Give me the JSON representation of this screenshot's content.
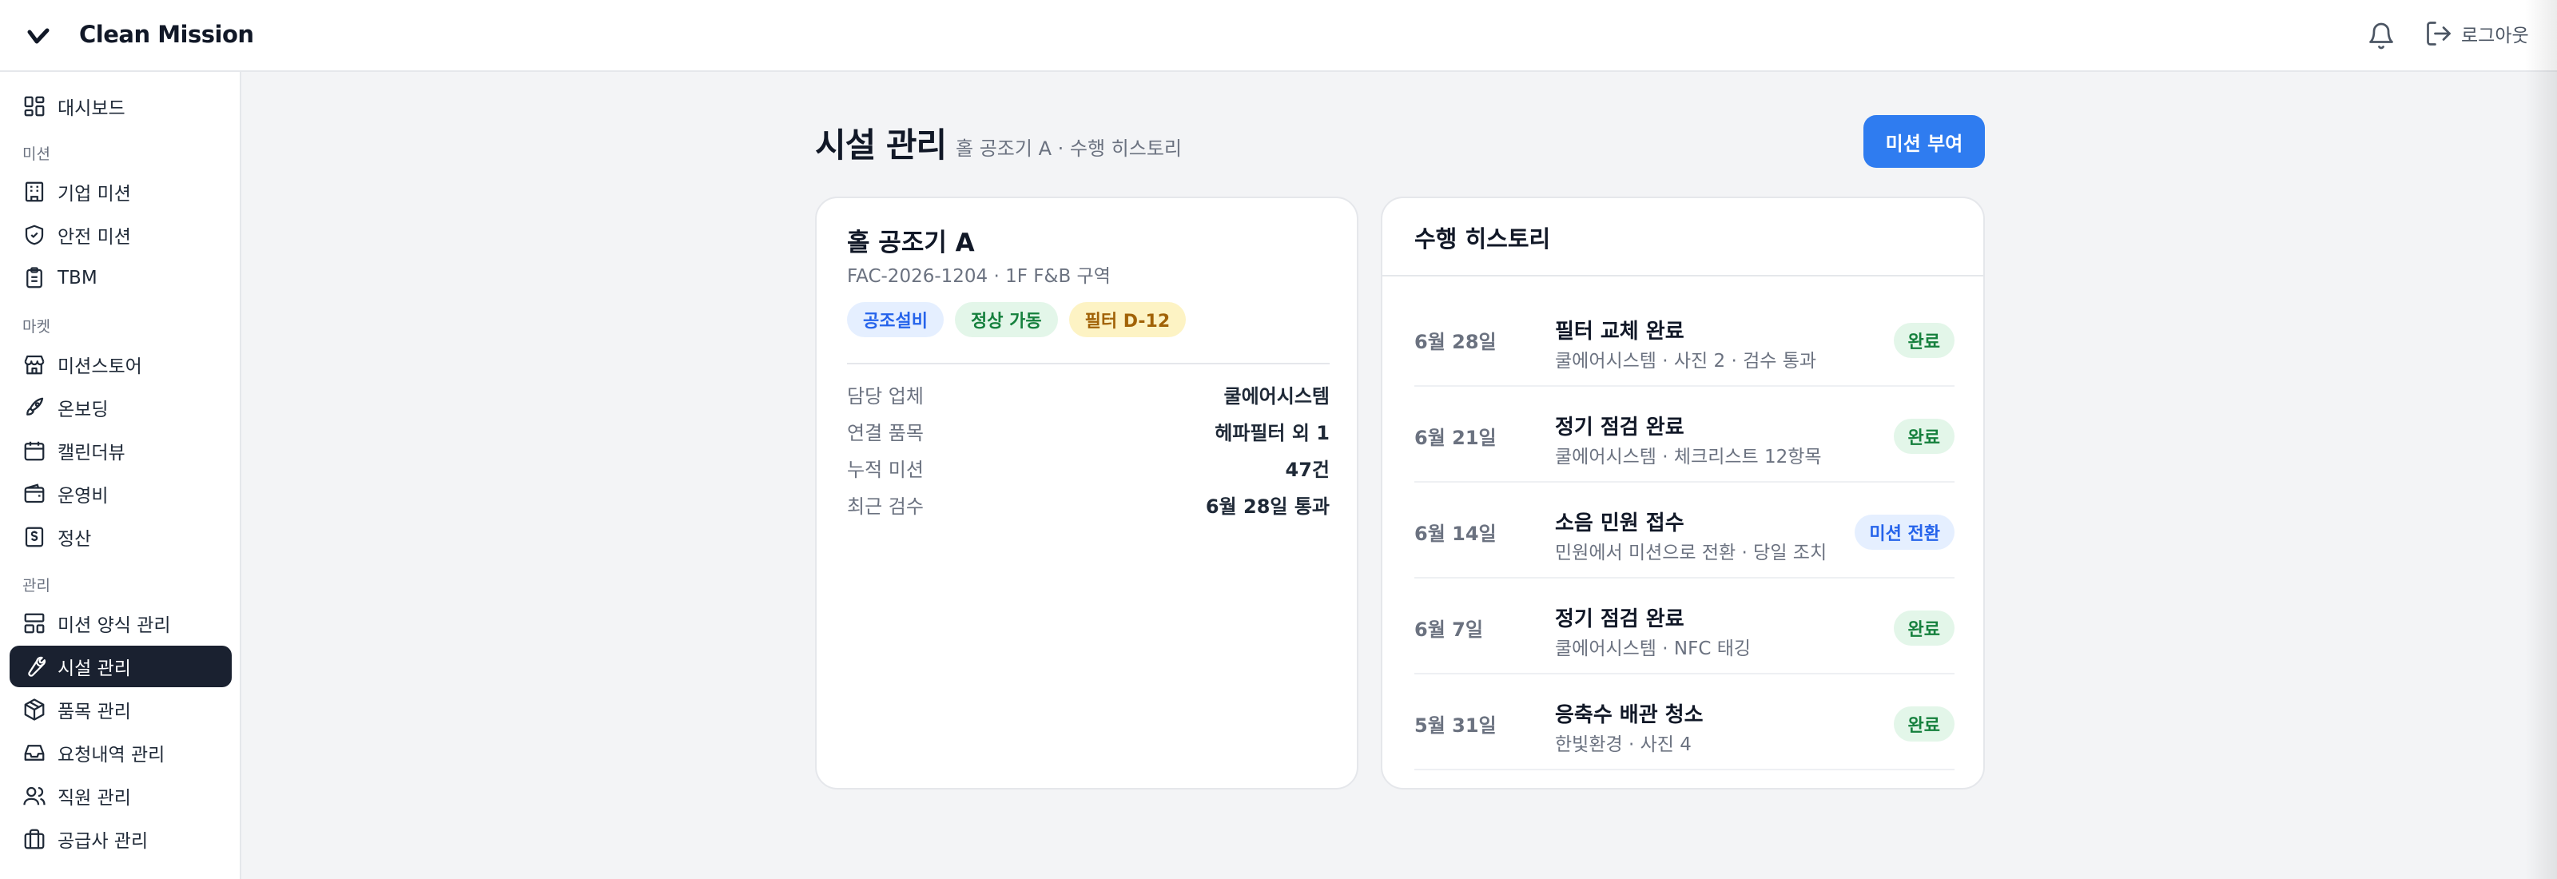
{
  "header": {
    "brand": "Clean Mission",
    "logout_label": "로그아웃"
  },
  "sidebar": {
    "top_item": "대시보드",
    "sections": [
      {
        "label": "미션",
        "items": [
          "기업 미션",
          "안전 미션",
          "TBM"
        ]
      },
      {
        "label": "마켓",
        "items": [
          "미션스토어",
          "온보딩",
          "캘린더뷰",
          "운영비",
          "정산"
        ]
      },
      {
        "label": "관리",
        "items": [
          "미션 양식 관리",
          "시설 관리",
          "품목 관리",
          "요청내역 관리",
          "직원 관리",
          "공급사 관리"
        ]
      }
    ],
    "active": "시설 관리"
  },
  "page": {
    "title": "시설 관리",
    "subtitle": "홀 공조기 A · 수행 히스토리",
    "primary_action": "미션 부여"
  },
  "facility": {
    "name": "홀 공조기 A",
    "code": "FAC-2026-1204 · 1F F&B 구역",
    "tags": [
      "공조설비",
      "정상 가동",
      "필터 D-12"
    ],
    "info": [
      {
        "key": "담당 업체",
        "value": "쿨에어시스템"
      },
      {
        "key": "연결 품목",
        "value": "헤파필터 외 1"
      },
      {
        "key": "누적 미션",
        "value": "47건"
      },
      {
        "key": "최근 검수",
        "value": "6월 28일 통과"
      }
    ]
  },
  "history": {
    "title": "수행 히스토리",
    "rows": [
      {
        "date": "6월 28일",
        "title": "필터 교체 완료",
        "detail": "쿨에어시스템 · 사진 2 · 검수 통과",
        "status": "완료"
      },
      {
        "date": "6월 21일",
        "title": "정기 점검 완료",
        "detail": "쿨에어시스템 · 체크리스트 12항목",
        "status": "완료"
      },
      {
        "date": "6월 14일",
        "title": "소음 민원 접수",
        "detail": "민원에서 미션으로 전환 · 당일 조치",
        "status": "미션 전환"
      },
      {
        "date": "6월 7일",
        "title": "정기 점검 완료",
        "detail": "쿨에어시스템 · NFC 태깅",
        "status": "완료"
      },
      {
        "date": "5월 31일",
        "title": "응축수 배관 청소",
        "detail": "한빛환경 · 사진 4",
        "status": "완료"
      }
    ]
  },
  "colors": {
    "accent": "#2f7cf0",
    "active_nav": "#1a2130",
    "success_bg": "#e3f6e9",
    "success_text": "#15803d"
  }
}
